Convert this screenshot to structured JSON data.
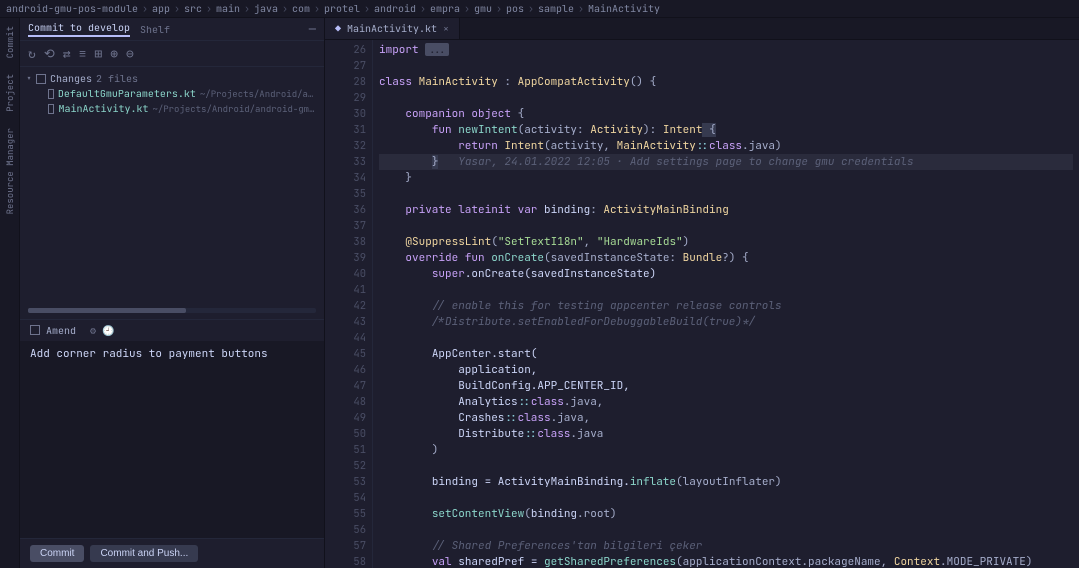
{
  "breadcrumb": [
    "android-gmu-pos-module",
    "app",
    "src",
    "main",
    "java",
    "com",
    "protel",
    "android",
    "empra",
    "gmu",
    "pos",
    "sample",
    "MainActivity"
  ],
  "commitPanel": {
    "tabActive": "Commit to develop",
    "tabInactive": "Shelf",
    "changesHeader": "Changes",
    "changesCount": "2 files",
    "files": [
      {
        "name": "DefaultGmuParameters.kt",
        "path": "~/Projects/Android/android-gmu-pos-module/..."
      },
      {
        "name": "MainActivity.kt",
        "path": "~/Projects/Android/android-gmu-pos-module/app/src/ma..."
      }
    ],
    "amendLabel": "Amend",
    "commitMessage": "Add corner radius to payment buttons",
    "commitBtn": "Commit",
    "commitPushBtn": "Commit and Push..."
  },
  "editor": {
    "tabName": "MainActivity.kt",
    "lines": {
      "26": {
        "kw": "import",
        "pill": "..."
      },
      "28": {
        "kw1": "class",
        "name": "MainActivity",
        "punc1": " : ",
        "type": "AppCompatActivity",
        "punc2": "() {"
      },
      "30": {
        "kw": "companion object",
        "brace": " {"
      },
      "31": {
        "kw": "fun",
        "fn": " newIntent",
        "sig1": "(activity: ",
        "type1": "Activity",
        "sig2": "): ",
        "type2": "Intent",
        "brace": " {"
      },
      "32": {
        "kw": "return",
        "type": " Intent",
        "args1": "(activity, ",
        "type2": "MainActivity",
        "op": "::",
        "kw2": "class",
        "args2": ".java)"
      },
      "33": {
        "brace": "}",
        "inlay": "   Yasar, 24.01.2022 12:05 · Add settings page to change gmu credentials"
      },
      "34": {
        "brace": "}"
      },
      "36": {
        "kw": "private lateinit var",
        "id": " binding",
        "punc": ": ",
        "type": "ActivityMainBinding"
      },
      "38": {
        "ann": "@SuppressLint",
        "args": "(",
        "s1": "\"SetTextI18n\"",
        "c": ", ",
        "s2": "\"HardwareIds\"",
        "close": ")"
      },
      "39": {
        "kw": "override fun",
        "fn": " onCreate",
        "sig": "(savedInstanceState: ",
        "type": "Bundle",
        "q": "?) {"
      },
      "40": {
        "kw": "super",
        "call": ".onCreate(savedInstanceState)"
      },
      "42": {
        "cmt": "// enable this for testing appcenter release controls"
      },
      "43": {
        "cmt": "/*Distribute.setEnabledForDebuggableBuild(true)*/"
      },
      "45": {
        "call": "AppCenter.start("
      },
      "46": {
        "id": "application,"
      },
      "47": {
        "id": "BuildConfig.APP_CENTER_ID,"
      },
      "48": {
        "id": "Analytics",
        "op": "::",
        "kw": "class",
        "tail": ".java,"
      },
      "49": {
        "id": "Crashes",
        "op": "::",
        "kw": "class",
        "tail": ".java,"
      },
      "50": {
        "id": "Distribute",
        "op": "::",
        "kw": "class",
        "tail": ".java"
      },
      "51": {
        "brace": ")"
      },
      "53": {
        "id": "binding = ActivityMainBinding.",
        "fn": "inflate",
        "args": "(layoutInflater)"
      },
      "55": {
        "fn": "setContentView",
        "args": "(",
        "u": "binding",
        "tail": ".root)"
      },
      "57": {
        "cmt": "// Shared Preferences'tan bilgileri çeker"
      },
      "58": {
        "kw": "val",
        "id": " sharedPref = ",
        "fn": "getSharedPreferences",
        "args": "(applicationContext.packageName, ",
        "type": "Context",
        "tail": ".MODE_PRIVATE)"
      }
    }
  },
  "tools": {
    "commit": "Commit",
    "project": "Project",
    "resmgr": "Resource Manager"
  }
}
